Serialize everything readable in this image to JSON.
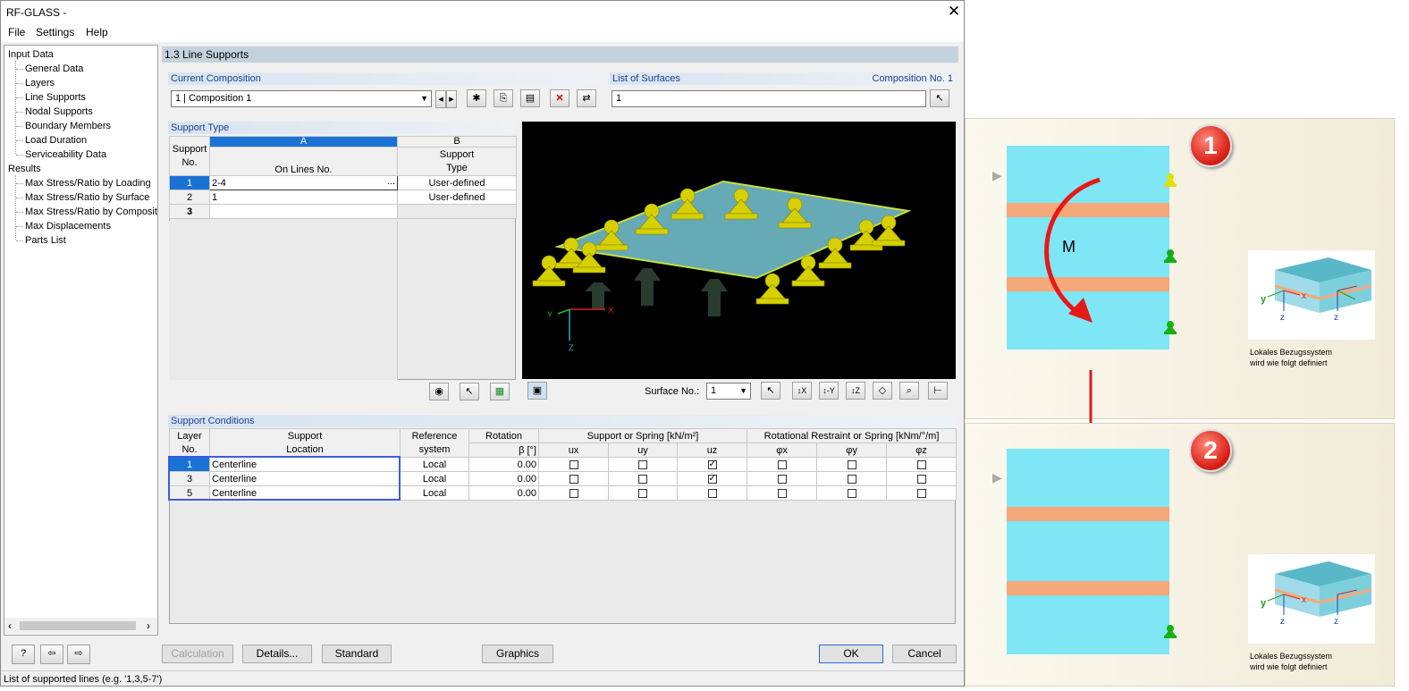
{
  "window": {
    "title": "RF-GLASS -"
  },
  "menu": [
    "File",
    "Settings",
    "Help"
  ],
  "nav": {
    "input_header": "Input Data",
    "input_items": [
      "General Data",
      "Layers",
      "Line Supports",
      "Nodal Supports",
      "Boundary Members",
      "Load Duration",
      "Serviceability Data"
    ],
    "results_header": "Results",
    "results_items": [
      "Max Stress/Ratio by Loading",
      "Max Stress/Ratio by Surface",
      "Max Stress/Ratio by Compositio",
      "Max Displacements",
      "Parts List"
    ]
  },
  "section_title": "1.3 Line Supports",
  "current_composition": {
    "label": "Current Composition",
    "value": "1 | Composition 1"
  },
  "list_of_surfaces": {
    "label": "List of Surfaces",
    "composition_no": "Composition No. 1",
    "value": "1"
  },
  "support_type": {
    "label": "Support Type",
    "col_a": "A",
    "col_b": "B",
    "row_header": "Support No.",
    "col_a_header": "On Lines No.",
    "col_b_header": "Support Type",
    "rows": [
      {
        "no": "1",
        "lines": "2-4",
        "type": "User-defined"
      },
      {
        "no": "2",
        "lines": "1",
        "type": "User-defined"
      },
      {
        "no": "3",
        "lines": "",
        "type": ""
      }
    ],
    "ellipsis": "..."
  },
  "graphics": {
    "surface_label": "Surface No.:",
    "surface_value": "1",
    "axes": {
      "x": "X",
      "y": "Y",
      "z": "Z"
    }
  },
  "support_conditions": {
    "label": "Support Conditions",
    "headers": {
      "layer": "Layer No.",
      "location": "Support Location",
      "reference": "Reference system",
      "rotation": "Rotation",
      "rotation_unit": "β [°]",
      "spring": "Support or Spring [kN/m²]",
      "rot_spring": "Rotational Restraint or Spring [kNm/°/m]",
      "sub": [
        "ux",
        "uy",
        "uz",
        "φx",
        "φy",
        "φz"
      ]
    },
    "rows": [
      {
        "layer": "1",
        "location": "Centerline",
        "ref": "Local",
        "rotation": "0.00",
        "checks": [
          false,
          false,
          true,
          false,
          false,
          false
        ]
      },
      {
        "layer": "3",
        "location": "Centerline",
        "ref": "Local",
        "rotation": "0.00",
        "checks": [
          false,
          false,
          true,
          false,
          false,
          false
        ]
      },
      {
        "layer": "5",
        "location": "Centerline",
        "ref": "Local",
        "rotation": "0.00",
        "checks": [
          false,
          false,
          false,
          false,
          false,
          false
        ]
      }
    ]
  },
  "buttons": {
    "calculation": "Calculation",
    "details": "Details...",
    "standard": "Standard",
    "graphics": "Graphics",
    "ok": "OK",
    "cancel": "Cancel"
  },
  "status": "List of supported lines (e.g. '1,3,5-7')",
  "illustration": {
    "step1": "1",
    "step2": "2",
    "moment": "M",
    "caption_line1": "Lokales Bezugssystem",
    "caption_line2": "wird wie folgt definiert",
    "axis_x": "x",
    "axis_y": "y",
    "axis_z": "z",
    "colors": {
      "glass": "#7fe6f5",
      "interlayer": "#f5a87a",
      "arrow": "#e81818",
      "support": "#14b014"
    }
  }
}
